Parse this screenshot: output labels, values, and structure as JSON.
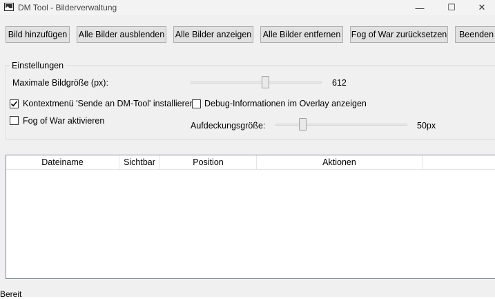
{
  "window": {
    "title": "DM Tool - Bilderverwaltung",
    "controls": {
      "minimize": "—",
      "maximize": "☐",
      "close": "✕"
    }
  },
  "toolbar": {
    "add_image": "Bild hinzufügen",
    "hide_all": "Alle Bilder ausblenden",
    "show_all": "Alle Bilder anzeigen",
    "remove_all": "Alle Bilder entfernen",
    "reset_fog": "Fog of War zurücksetzen",
    "exit": "Beenden"
  },
  "settings": {
    "group_title": "Einstellungen",
    "max_size_label": "Maximale Bildgröße (px):",
    "max_size_value": "612",
    "context_menu_label": "Kontextmenü 'Sende an DM-Tool' installieren",
    "context_menu_checked": true,
    "debug_label": "Debug-Informationen im Overlay anzeigen",
    "debug_checked": false,
    "fog_label": "Fog of War aktivieren",
    "fog_checked": false,
    "reveal_size_label": "Aufdeckungsgröße:",
    "reveal_size_value": "50px"
  },
  "table": {
    "columns": [
      "Dateiname",
      "Sichtbar",
      "Position",
      "Aktionen"
    ],
    "rows": []
  },
  "status": {
    "text": "Bereit"
  }
}
